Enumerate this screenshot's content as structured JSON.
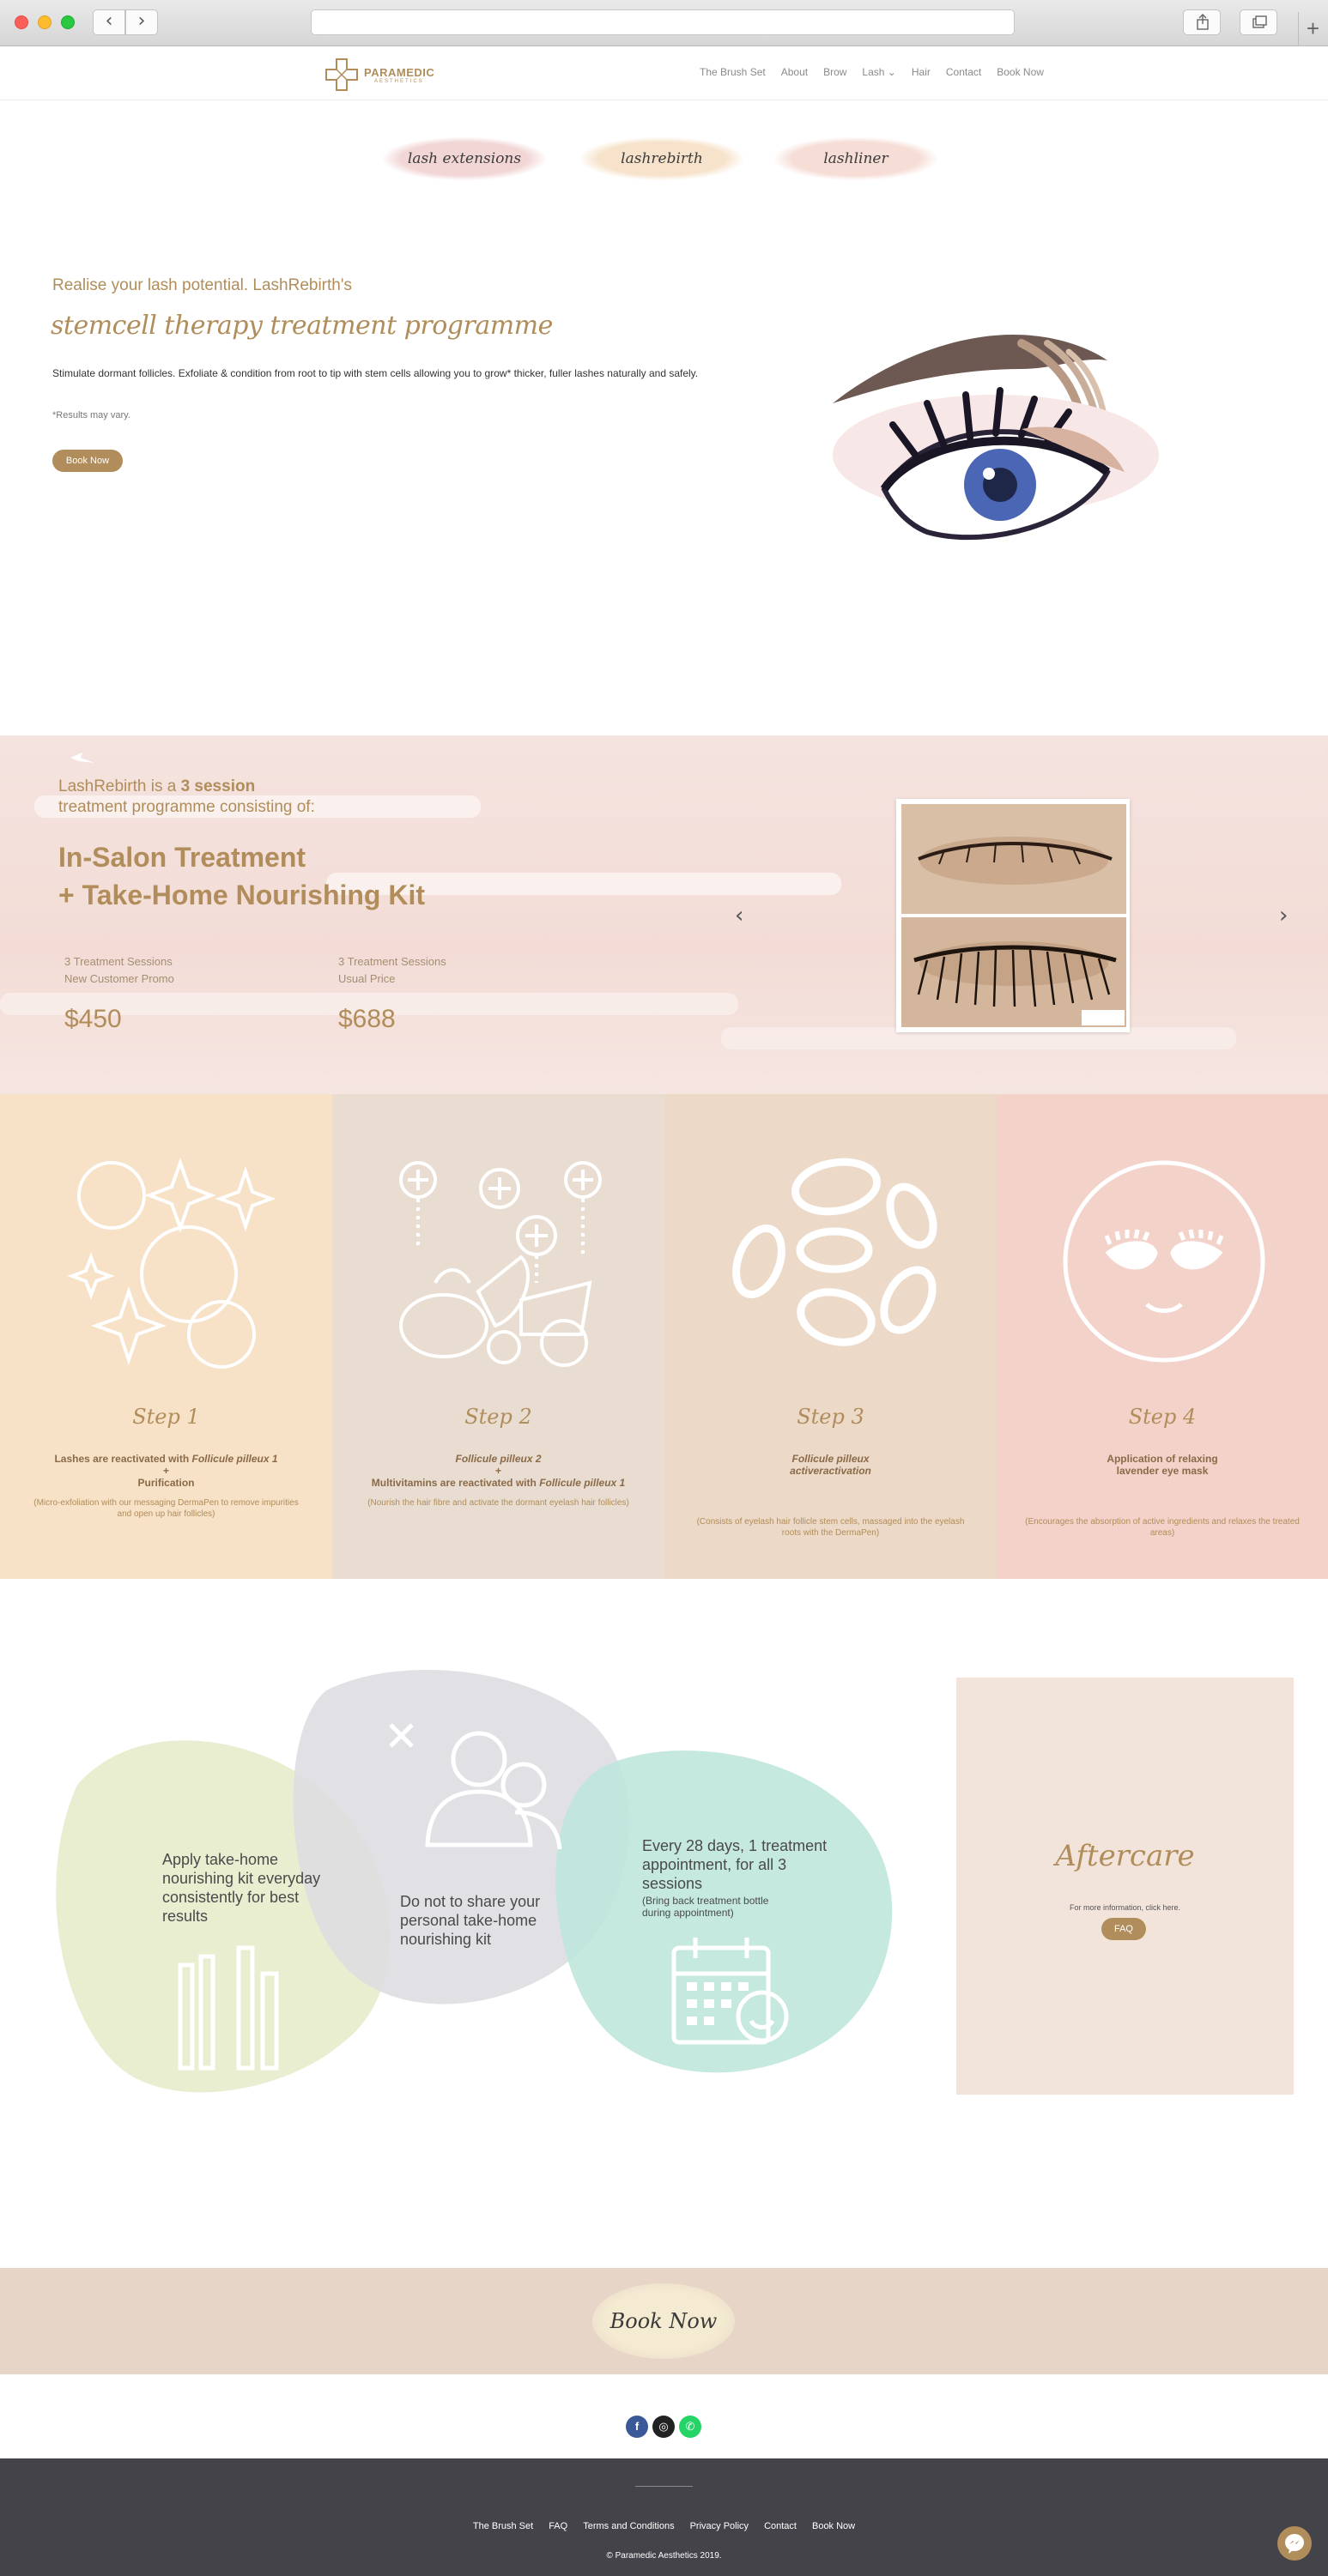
{
  "browser": {
    "back": "‹",
    "forward": "›",
    "plus": "+"
  },
  "nav": {
    "logo_text": "PARAMEDIC",
    "logo_sub": "AESTHETICS",
    "links": [
      "The Brush Set",
      "About",
      "Brow",
      "Lash",
      "Hair",
      "Contact",
      "Book Now"
    ],
    "lash_chevron": "⌄"
  },
  "tabs": [
    "lash extensions",
    "lashrebirth",
    "lashliner"
  ],
  "hero": {
    "intro": "Realise your lash potential. LashRebirth's",
    "script_title": "stemcell therapy treatment programme",
    "description": "Stimulate dormant follicles. Exfoliate & condition from root to tip with stem cells allowing you to grow* thicker, fuller lashes naturally and safely.",
    "note": "*Results may vary.",
    "button": "Book Now"
  },
  "program": {
    "intro_prefix": "LashRebirth is a ",
    "intro_bold": "3 session",
    "intro_line2": "treatment programme consisting of:",
    "title_line1": "In-Salon Treatment",
    "title_line2": "+ Take-Home Nourishing Kit",
    "prices": [
      {
        "line1": "3 Treatment Sessions",
        "line2": "New Customer Promo",
        "price": "$450"
      },
      {
        "line1": "3 Treatment Sessions",
        "line2": "Usual Price",
        "price": "$688"
      }
    ],
    "arrow_left": "‹",
    "arrow_right": "›"
  },
  "steps": [
    {
      "title": "Step 1",
      "head_pre": "Lashes are reactivated with ",
      "head_em": "Follicule pilleux 1",
      "head_plus": "+",
      "head_line3": "Purification",
      "sub": "(Micro-exfoliation with our messaging DermaPen to remove impurities and open up hair follicles)"
    },
    {
      "title": "Step 2",
      "head_em1": "Follicule pilleux 2",
      "head_plus": "+",
      "head_pre2": "Multivitamins are reactivated with ",
      "head_em2": "Follicule pilleux 1",
      "sub": "(Nourish the hair fibre and activate the dormant eyelash hair follicles)"
    },
    {
      "title": "Step 3",
      "head_line1": "Follicule pilleux",
      "head_line2": "activeractivation",
      "sub": "(Consists of eyelash hair follicle stem cells, massaged into the eyelash roots with the DermaPen)"
    },
    {
      "title": "Step 4",
      "head_line1": "Application of relaxing",
      "head_line2": "lavender eye mask",
      "sub": "(Encourages the absorption of active ingredients and relaxes the treated areas)"
    }
  ],
  "blobs": {
    "green": "Apply take-home nourishing kit everyday consistently for best results",
    "grey": "Do not to share your personal take-home nourishing kit",
    "teal_main": "Every 28 days, 1 treatment appointment, for all 3 sessions",
    "teal_small": "(Bring back treatment bottle during appointment)"
  },
  "aftercare": {
    "title": "Aftercare",
    "info": "For more information, click here.",
    "button": "FAQ"
  },
  "booknow": {
    "label": "Book Now"
  },
  "social": {
    "facebook": "f",
    "instagram": "◎",
    "whatsapp": "✆"
  },
  "footer": {
    "links": [
      "The Brush Set",
      "FAQ",
      "Terms and Conditions",
      "Privacy Policy",
      "Contact",
      "Book Now"
    ],
    "copyright": "© Paramedic Aesthetics 2019."
  },
  "colors": {
    "accent": "#b08d5a",
    "footer_bg": "#444349"
  }
}
